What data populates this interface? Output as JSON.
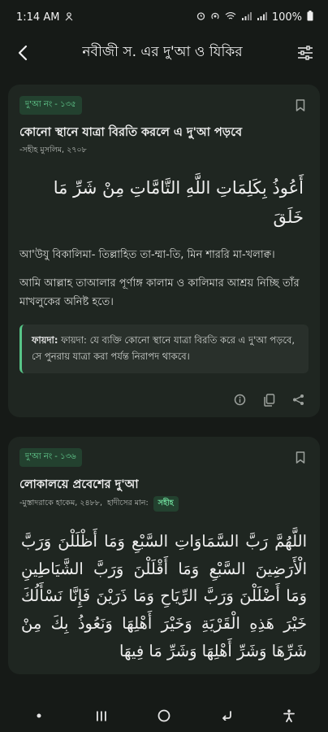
{
  "status": {
    "time": "1:14 AM",
    "battery": "100%"
  },
  "appbar": {
    "title": "নবীজী স. এর দু'আ ও যিকির"
  },
  "cards": [
    {
      "badge": "দু'আ নং - ১৩৫",
      "title": "কোনো স্থানে যাত্রা বিরতি করলে এ দু'আ পড়বে",
      "reference": "-সহীহ মুসলিম, ২৭০৮",
      "arabic": "أَعُوذُ بِكَلِمَاتِ اللَّهِ التَّامَّاتِ مِنْ شَرِّ مَا خَلَقَ",
      "transliteration": "আ'উযু বিকালিমা- তিল্লাহিত তা-ম্মা-তি, মিন শাররি মা-খলাক্ব।",
      "meaning": "আমি আল্লাহ তাআলার পূর্ণাঙ্গ কালাম ও কালিমার আশ্রয় নিচ্ছি তাঁর মাখলুকের অনিষ্ট হতে।",
      "benefit_label": "ফায়দা:",
      "benefit_text": "ফায়দা: যে ব্যক্তি কোনো স্থানে যাত্রা বিরতি করে এ দু'আ পড়বে, সে পুনরায় যাত্রা করা পর্যন্ত নিরাপদ থাকবে।"
    },
    {
      "badge": "দু'আ নং - ১৩৬",
      "title": "লোকালয়ে প্রবেশের দু'আ",
      "reference": "-মুস্তাদরাকে হাকেম, ২৪৮৮,",
      "hadith_grade_label": "হাদীসের মান:",
      "grade": "সহীহ",
      "arabic": "اللَّهُمَّ رَبَّ السَّمَاوَاتِ السَّبْعِ وَمَا أَظْلَلْنَ وَرَبَّ الْأَرَضِينَ السَّبْعِ وَمَا أَقْلَلْنَ وَرَبَّ الشَّيَاطِينِ وَمَا أَضْلَلْنَ وَرَبَّ الرِّيَاحِ وَمَا ذَرَيْنَ فَإِنَّا نَسْأَلُكَ خَيْرَ هَذِهِ الْقَرْيَةِ وَخَيْرَ أَهْلِهَا وَنَعُوذُ بِكَ مِنْ شَرِّهَا وَشَرِّ أَهْلِهَا وَشَرِّ مَا فِيهَا"
    }
  ],
  "icons": {
    "back": "chevron-left-icon",
    "filter": "sliders-icon",
    "bookmark": "bookmark-icon",
    "info": "info-icon",
    "copy": "copy-icon",
    "share": "share-icon"
  },
  "colors": {
    "background": "#161a17",
    "card": "#1f2621",
    "accent": "#68d796",
    "badge_bg": "#23412f"
  }
}
